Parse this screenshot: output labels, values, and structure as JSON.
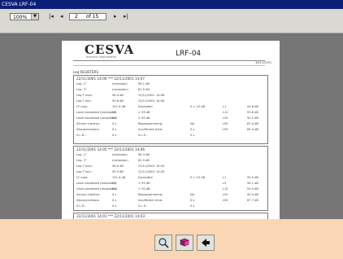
{
  "window": {
    "title": "CESVA LRF-04"
  },
  "toolbar": {
    "zoom_value": "100%",
    "first_page": "|◂",
    "prev_page": "◂",
    "page_current": "2",
    "page_of": "of 15",
    "next_page": "▸",
    "last_page": "▸|"
  },
  "report": {
    "logo": "CESVA",
    "tagline": "acoustic instruments",
    "title": "LRF-04",
    "date": "16/11/2001",
    "section": "Leq REGISTERS:"
  },
  "blocks": [
    {
      "header": "22/11/2001 14:06  ***  22/11/2001 14:07",
      "rows": [
        [
          "Leq. 1°",
          "(emission)",
          "96.1 dB",
          "",
          "",
          "",
          ""
        ],
        [
          "Leq. 2°",
          "(reception)",
          "81.5 dB",
          "",
          "",
          "",
          ""
        ],
        [
          "Leq T max:",
          "96.4 dB",
          "22/11/2001",
          "14:06",
          "",
          "",
          ""
        ],
        [
          "Leq T min:",
          "95.8 dB",
          "22/11/2001",
          "14:06",
          "",
          "",
          ""
        ],
        [
          "LF max:",
          "101.0 dB",
          "Exceeded",
          "",
          "0 > 10 dB",
          "L1",
          "94.8 dB"
        ],
        [
          "Level exceeded (emission):",
          "NO",
          "> 95 dB",
          "",
          "",
          "L10",
          "93.6 dB"
        ],
        [
          "Level exceeded (reception):",
          "NO",
          "> 90 dB",
          "",
          "",
          "L50",
          "90.2 dB"
        ],
        [
          "Sensor inactive:",
          "0 s",
          "Reprogramming:",
          "",
          "No",
          "L90",
          "87.4 dB"
        ],
        [
          "Disconnections:",
          "0 s",
          "Insufficient time:",
          "",
          "0 s",
          "L99",
          "85.0 dB"
        ],
        [
          "S.L.D.:",
          "0 s",
          "S.L.E.:",
          "",
          "0 s",
          "",
          ""
        ]
      ]
    },
    {
      "header": "22/11/2001 14:05  ***  22/11/2001 14:06",
      "rows": [
        [
          "Leq. 1°",
          "(emission)",
          "96.3 dB",
          "",
          "",
          "",
          ""
        ],
        [
          "Leq. 2°",
          "(reception)",
          "81.9 dB",
          "",
          "",
          "",
          ""
        ],
        [
          "Leq T max:",
          "96.6 dB",
          "22/11/2001",
          "14:05",
          "",
          "",
          ""
        ],
        [
          "Leq T min:",
          "95.9 dB",
          "22/11/2001",
          "14:05",
          "",
          "",
          ""
        ],
        [
          "LF max:",
          "101.4 dB",
          "Exceeded",
          "",
          "0 > 10 dB",
          "L1",
          "95.0 dB"
        ],
        [
          "Level exceeded (emission):",
          "NO",
          "> 95 dB",
          "",
          "",
          "L5",
          "94.1 dB"
        ],
        [
          "Level exceeded (reception):",
          "NO",
          "> 90 dB",
          "",
          "",
          "L10",
          "93.9 dB"
        ],
        [
          "Sensor inactive:",
          "0 s",
          "Reprogramming:",
          "",
          "No",
          "L50",
          "90.4 dB"
        ],
        [
          "Disconnections:",
          "0 s",
          "Insufficient time:",
          "",
          "0 s",
          "L90",
          "87.7 dB"
        ],
        [
          "S.L.D.:",
          "0 s",
          "S.L.E.:",
          "",
          "0 s",
          "",
          ""
        ]
      ]
    },
    {
      "header": "22/11/2001 14:01  ***  22/11/2001 14:03",
      "rows": [
        [
          "Leq. 1°",
          "(emission)",
          "96.0 dB",
          "",
          "",
          "",
          ""
        ]
      ]
    }
  ],
  "bottom_buttons": [
    {
      "icon": "magnifier-icon"
    },
    {
      "icon": "book-icon"
    },
    {
      "icon": "back-arrow-icon"
    }
  ]
}
